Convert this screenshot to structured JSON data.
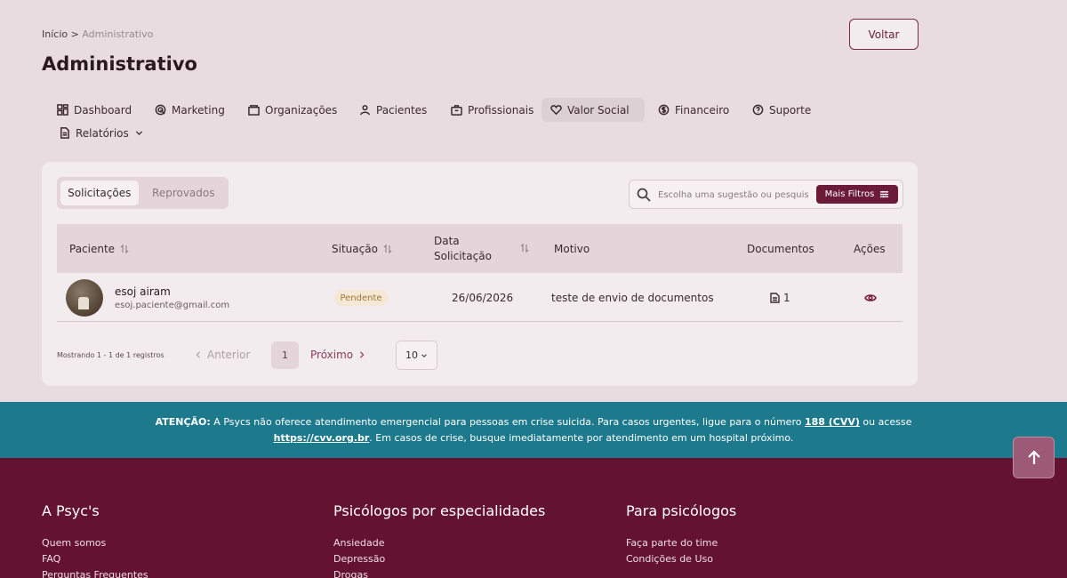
{
  "breadcrumb": {
    "home": "Início",
    "separator": ">",
    "current": "Administrativo"
  },
  "page_title": "Administrativo",
  "back_button": "Voltar",
  "nav": [
    {
      "label": "Dashboard",
      "icon": "dashboard-icon"
    },
    {
      "label": "Marketing",
      "icon": "marketing-icon"
    },
    {
      "label": "Organizações",
      "icon": "organizations-icon"
    },
    {
      "label": "Pacientes",
      "icon": "user-icon"
    },
    {
      "label": "Profissionais",
      "icon": "briefcase-icon"
    },
    {
      "label": "Valor Social",
      "icon": "heart-icon",
      "active": true
    },
    {
      "label": "Financeiro",
      "icon": "dollar-icon"
    },
    {
      "label": "Suporte",
      "icon": "support-icon"
    },
    {
      "label": "Relatórios",
      "icon": "report-icon"
    }
  ],
  "tabs": {
    "active": "Solicitações",
    "inactive": "Reprovados"
  },
  "search": {
    "placeholder": "Escolha uma sugestão ou pesquise",
    "filter_button": "Mais Filtros"
  },
  "table": {
    "headers": {
      "patient": "Paciente",
      "status": "Situação",
      "date_line1": "Data",
      "date_line2": "Solicitação",
      "reason": "Motivo",
      "documents": "Documentos",
      "actions": "Ações"
    },
    "rows": [
      {
        "name": "esoj airam",
        "email": "esoj.paciente@gmail.com",
        "status": "Pendente",
        "date": "26/06/2026",
        "reason": "teste de envio de documentos",
        "documents": "1"
      }
    ]
  },
  "pagination": {
    "showing": "Mostrando 1 - 1 de 1 registros",
    "prev": "Anterior",
    "page": "1",
    "next": "Próximo",
    "per_page": "10"
  },
  "warning": {
    "label": "ATENÇÃO:",
    "text1": "A Psycs não oferece atendimento emergencial para pessoas em crise suicida. Para casos urgentes, ligue para o número",
    "phone": "188 (CVV)",
    "text2": "ou acesse",
    "link": "https://cvv.org.br",
    "text3": ". Em casos de crise, busque imediatamente por atendimento em um hospital próximo."
  },
  "footer": {
    "col1": {
      "title": "A Psyc's",
      "links": [
        "Quem somos",
        "FAQ",
        "Perguntas Frequentes"
      ]
    },
    "col2": {
      "title": "Psicólogos por especialidades",
      "links": [
        "Ansiedade",
        "Depressão",
        "Drogas"
      ]
    },
    "col3": {
      "title": "Para psicólogos",
      "links": [
        "Faça parte do time",
        "Condições de Uso"
      ]
    }
  },
  "colors": {
    "brand": "#63132f",
    "accent": "#6b1a38",
    "warning_bg": "#1d7a8c",
    "pending_badge": "#f5e8d4"
  }
}
